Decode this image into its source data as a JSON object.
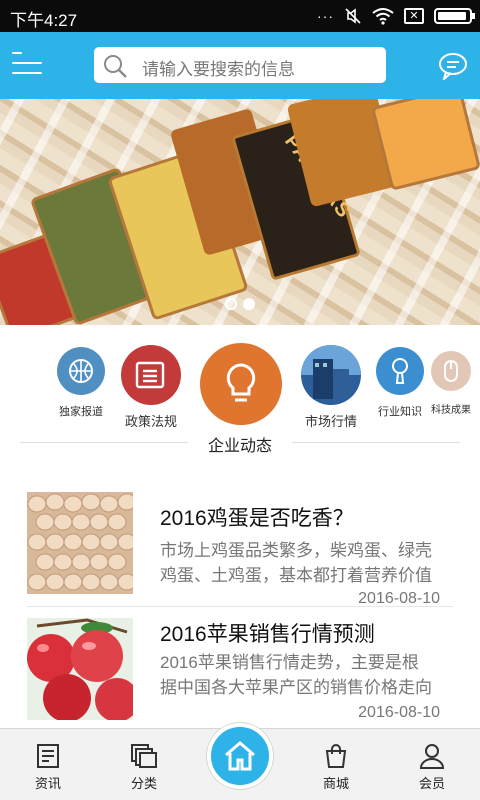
{
  "status_bar": {
    "time": "下午4:27",
    "icons": [
      "more-dots-icon",
      "mute-icon",
      "wifi-icon",
      "no-sim-icon",
      "battery-icon"
    ]
  },
  "header": {
    "search_placeholder": "请输入要搜索的信息",
    "brand_color": "#2eb3e9"
  },
  "banner": {
    "slide_text": "PALETAS",
    "page_count": 2,
    "active_page": 2
  },
  "categories": [
    {
      "label": "独家报道",
      "icon": "basketball-icon",
      "color": "#4f8fc2"
    },
    {
      "label": "政策法规",
      "icon": "document-icon",
      "color": "#c23a3a"
    },
    {
      "label": "企业动态",
      "icon": "lightbulb-icon",
      "color": "#e0752f"
    },
    {
      "label": "市场行情",
      "icon": "building-photo-icon",
      "color": "#2b5e9a"
    },
    {
      "label": "行业知识",
      "icon": "microphone-icon",
      "color": "#3b8fd1"
    },
    {
      "label": "科技成果",
      "icon": "mouse-icon",
      "color": "#e3c7b6"
    }
  ],
  "news": [
    {
      "title": "2016鸡蛋是否吃香？",
      "desc_line1": "市场上鸡蛋品类繁多，柴鸡蛋、绿壳",
      "desc_line2": "鸡蛋、土鸡蛋，基本都打着营养价值",
      "date": "2016-08-10",
      "thumb": "eggs-photo"
    },
    {
      "title": "2016苹果销售行情预测",
      "desc_line1": "2016苹果销售行情走势，主要是根",
      "desc_line2": "据中国各大苹果产区的销售价格走向",
      "date": "2016-08-10",
      "thumb": "apples-photo"
    }
  ],
  "bottom_nav": {
    "items": [
      {
        "label": "资讯",
        "icon": "news-icon"
      },
      {
        "label": "分类",
        "icon": "category-icon"
      },
      {
        "label": "",
        "icon": "home-icon"
      },
      {
        "label": "商城",
        "icon": "shopping-bag-icon"
      },
      {
        "label": "会员",
        "icon": "user-icon"
      }
    ]
  }
}
